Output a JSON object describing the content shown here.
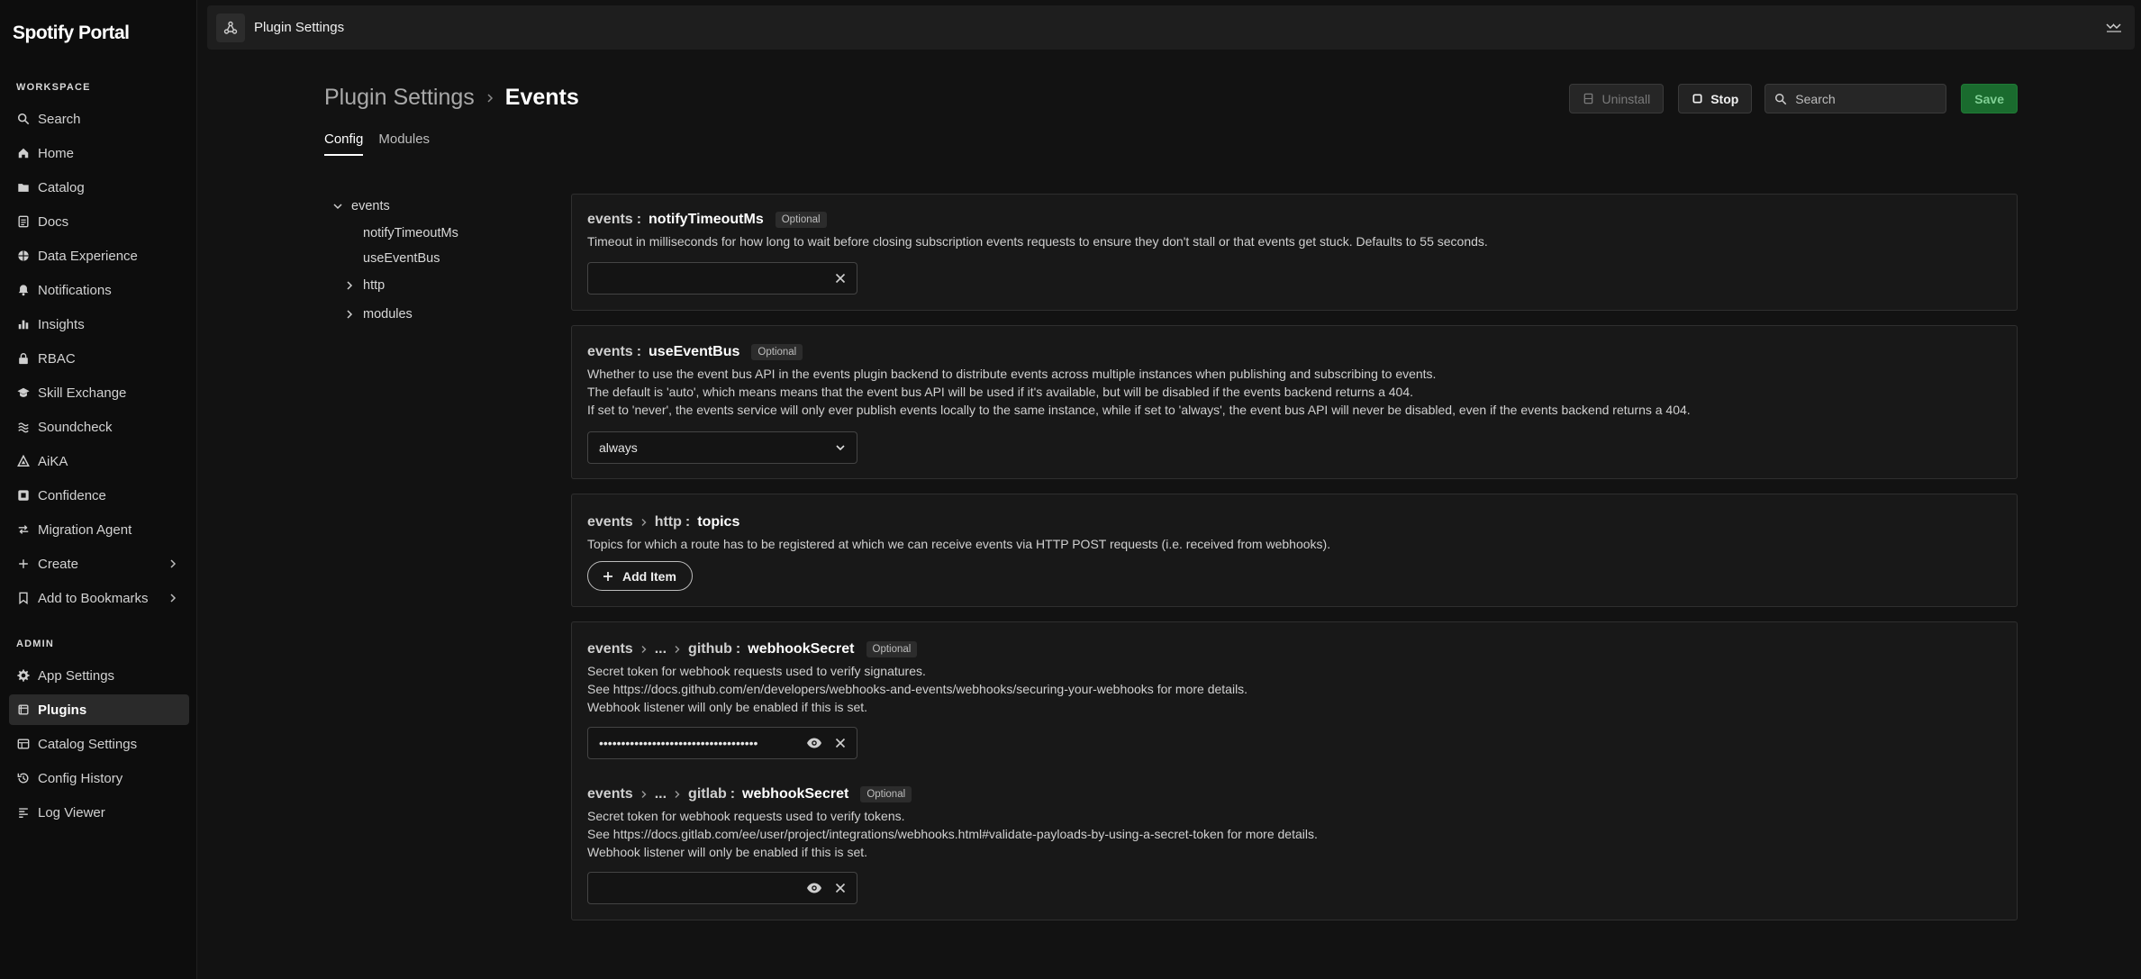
{
  "brand": "Spotify Portal",
  "sidebar": {
    "workspace_label": "WORKSPACE",
    "workspace_items": [
      {
        "label": "Search"
      },
      {
        "label": "Home"
      },
      {
        "label": "Catalog"
      },
      {
        "label": "Docs"
      },
      {
        "label": "Data Experience"
      },
      {
        "label": "Notifications"
      },
      {
        "label": "Insights"
      },
      {
        "label": "RBAC"
      },
      {
        "label": "Skill Exchange"
      },
      {
        "label": "Soundcheck"
      },
      {
        "label": "AiKA"
      },
      {
        "label": "Confidence"
      },
      {
        "label": "Migration Agent"
      },
      {
        "label": "Create"
      },
      {
        "label": "Add to Bookmarks"
      }
    ],
    "admin_label": "ADMIN",
    "admin_items": [
      {
        "label": "App Settings"
      },
      {
        "label": "Plugins"
      },
      {
        "label": "Catalog Settings"
      },
      {
        "label": "Config History"
      },
      {
        "label": "Log Viewer"
      }
    ]
  },
  "topbar": {
    "title": "Plugin Settings"
  },
  "header": {
    "breadcrumb_parent": "Plugin Settings",
    "breadcrumb_current": "Events",
    "uninstall_label": "Uninstall",
    "stop_label": "Stop",
    "search_placeholder": "Search",
    "save_label": "Save"
  },
  "tabs": [
    {
      "label": "Config"
    },
    {
      "label": "Modules"
    }
  ],
  "tree": {
    "root": "events",
    "children": [
      "notifyTimeoutMs",
      "useEventBus",
      "http",
      "modules"
    ]
  },
  "fields": {
    "notify": {
      "path": [
        "events"
      ],
      "key": "notifyTimeoutMs",
      "badge": "Optional",
      "desc": [
        "Timeout in milliseconds for how long to wait before closing subscription events requests to ensure they don't stall or that events get stuck. Defaults to 55 seconds."
      ],
      "value": ""
    },
    "bus": {
      "path": [
        "events"
      ],
      "key": "useEventBus",
      "badge": "Optional",
      "desc": [
        "Whether to use the event bus API in the events plugin backend to distribute events across multiple instances when publishing and subscribing to events.",
        "The default is 'auto', which means means that the event bus API will be used if it's available, but will be disabled if the events backend returns a 404.",
        "If set to 'never', the events service will only ever publish events locally to the same instance, while if set to 'always', the event bus API will never be disabled, even if the events backend returns a 404."
      ],
      "value": "always"
    },
    "topics": {
      "path": [
        "events",
        "http"
      ],
      "key": "topics",
      "desc": [
        "Topics for which a route has to be registered at which we can receive events via HTTP POST requests (i.e. received from webhooks)."
      ],
      "add_label": "Add Item"
    },
    "github": {
      "path": [
        "events",
        "...",
        "github"
      ],
      "key": "webhookSecret",
      "badge": "Optional",
      "desc": [
        "Secret token for webhook requests used to verify signatures.",
        "See https://docs.github.com/en/developers/webhooks-and-events/webhooks/securing-your-webhooks for more details.",
        "Webhook listener will only be enabled if this is set."
      ],
      "value": "••••••••••••••••••••••••••••••••••••"
    },
    "gitlab": {
      "path": [
        "events",
        "...",
        "gitlab"
      ],
      "key": "webhookSecret",
      "badge": "Optional",
      "desc": [
        "Secret token for webhook requests used to verify tokens.",
        "See https://docs.gitlab.com/ee/user/project/integrations/webhooks.html#validate-payloads-by-using-a-secret-token for more details.",
        "Webhook listener will only be enabled if this is set."
      ],
      "value": ""
    }
  }
}
